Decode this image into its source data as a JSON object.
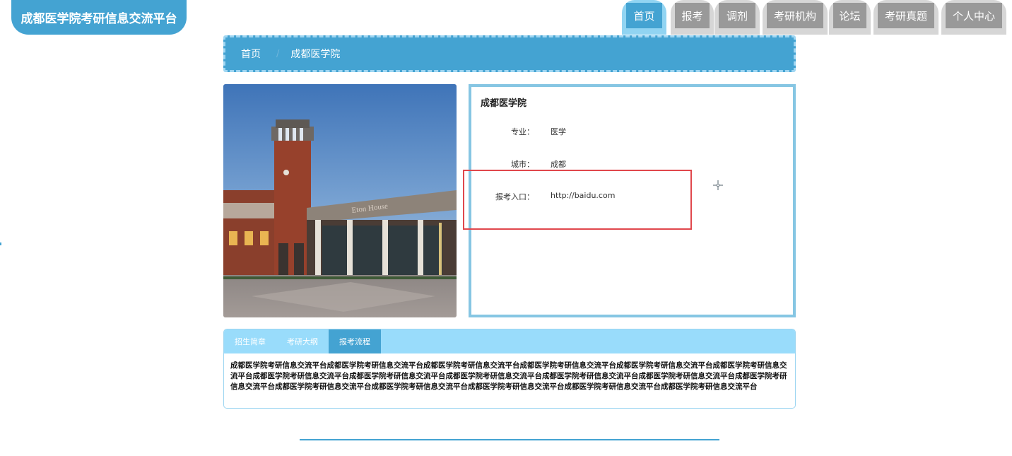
{
  "header": {
    "brand": "成都医学院考研信息交流平台"
  },
  "nav": {
    "items": [
      {
        "label": "首页",
        "active": true
      },
      {
        "label": "报考",
        "active": false
      },
      {
        "label": "调剂",
        "active": false
      },
      {
        "label": "考研机构",
        "active": false
      },
      {
        "label": "论坛",
        "active": false
      },
      {
        "label": "考研真题",
        "active": false
      },
      {
        "label": "个人中心",
        "active": false
      }
    ]
  },
  "breadcrumb": {
    "home": "首页",
    "separator": "/",
    "current": "成都医学院"
  },
  "school": {
    "name": "成都医学院",
    "major_label": "专业：",
    "major": "医学",
    "city_label": "城市：",
    "city": "成都",
    "entry_label": "报考入口：",
    "entry": "http://baidu.com"
  },
  "photo": {
    "sign_text": "Eton House"
  },
  "tabs": {
    "items": [
      {
        "label": "招生简章",
        "active": false
      },
      {
        "label": "考研大纲",
        "active": false
      },
      {
        "label": "报考流程",
        "active": true
      }
    ],
    "content": "成都医学院考研信息交流平台成都医学院考研信息交流平台成都医学院考研信息交流平台成都医学院考研信息交流平台成都医学院考研信息交流平台成都医学院考研信息交流平台成都医学院考研信息交流平台成都医学院考研信息交流平台成都医学院考研信息交流平台成都医学院考研信息交流平台成都医学院考研信息交流平台成都医学院考研信息交流平台成都医学院考研信息交流平台成都医学院考研信息交流平台成都医学院考研信息交流平台成都医学院考研信息交流平台成都医学院考研信息交流平台"
  },
  "colors": {
    "primary": "#44a3d2",
    "nav_inactive": "#999999",
    "highlight": "#e0474c"
  }
}
